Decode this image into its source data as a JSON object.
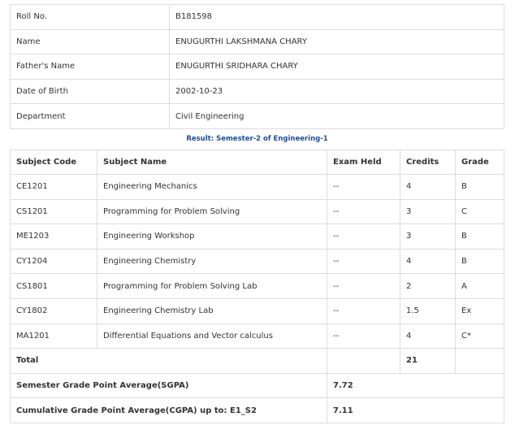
{
  "student": {
    "roll_label": "Roll No.",
    "roll_value": "B181598",
    "name_label": "Name",
    "name_value": "ENUGURTHI LAKSHMANA CHARY",
    "father_label": "Father's Name",
    "father_value": "ENUGURTHI SRIDHARA CHARY",
    "dob_label": "Date of Birth",
    "dob_value": "2002-10-23",
    "dept_label": "Department",
    "dept_value": "Civil Engineering"
  },
  "result_title": "Result: Semester-2 of Engineering-1",
  "table": {
    "headers": [
      "Subject Code",
      "Subject Name",
      "Exam Held",
      "Credits",
      "Grade"
    ],
    "rows": [
      [
        "CE1201",
        "Engineering Mechanics",
        "--",
        "4",
        "B"
      ],
      [
        "CS1201",
        "Programming for Problem Solving",
        "--",
        "3",
        "C"
      ],
      [
        "ME1203",
        "Engineering Workshop",
        "--",
        "3",
        "B"
      ],
      [
        "CY1204",
        "Engineering Chemistry",
        "--",
        "4",
        "B"
      ],
      [
        "CS1801",
        "Programming for Problem Solving Lab",
        "--",
        "2",
        "A"
      ],
      [
        "CY1802",
        "Engineering Chemistry Lab",
        "--",
        "1.5",
        "Ex"
      ],
      [
        "MA1201",
        "Differential Equations and Vector calculus",
        "--",
        "4",
        "C*"
      ]
    ],
    "total_label": "Total",
    "total_credits": "21",
    "sgpa_label": "Semester Grade Point Average(SGPA)",
    "sgpa_value": "7.72",
    "cgpa_label": "Cumulative Grade Point Average(CGPA) up to: E1_S2",
    "cgpa_value": "7.11"
  }
}
